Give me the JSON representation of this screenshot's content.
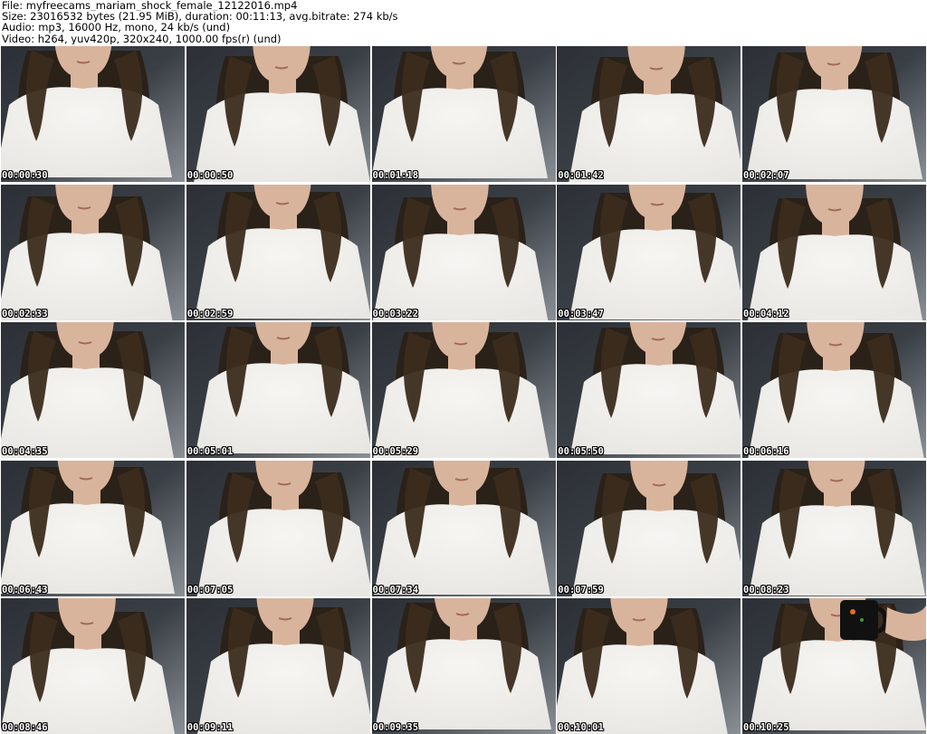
{
  "header": {
    "file_line": "File: myfreecams_mariam_shock_female_12122016.mp4",
    "size_line": "Size: 23016532 bytes (21.95 MiB), duration: 00:11:13, avg.bitrate: 274 kb/s",
    "audio_line": "Audio: mp3, 16000 Hz, mono, 24 kb/s (und)",
    "video_line": "Video: h264, yuv420p, 320x240, 1000.00 fps(r) (und)"
  },
  "thumbnails": [
    {
      "timestamp": "00:00:30"
    },
    {
      "timestamp": "00:00:50"
    },
    {
      "timestamp": "00:01:18"
    },
    {
      "timestamp": "00:01:42"
    },
    {
      "timestamp": "00:02:07"
    },
    {
      "timestamp": "00:02:33"
    },
    {
      "timestamp": "00:02:59"
    },
    {
      "timestamp": "00:03:22"
    },
    {
      "timestamp": "00:03:47"
    },
    {
      "timestamp": "00:04:12"
    },
    {
      "timestamp": "00:04:35"
    },
    {
      "timestamp": "00:05:01"
    },
    {
      "timestamp": "00:05:29"
    },
    {
      "timestamp": "00:05:50"
    },
    {
      "timestamp": "00:06:16"
    },
    {
      "timestamp": "00:06:43"
    },
    {
      "timestamp": "00:07:05"
    },
    {
      "timestamp": "00:07:34"
    },
    {
      "timestamp": "00:07:59"
    },
    {
      "timestamp": "00:08:23"
    },
    {
      "timestamp": "00:08:46"
    },
    {
      "timestamp": "00:09:11"
    },
    {
      "timestamp": "00:09:35"
    },
    {
      "timestamp": "00:10:01"
    },
    {
      "timestamp": "00:10:25"
    }
  ],
  "colors": {
    "background": "#ffffff",
    "header_text": "#000000",
    "timestamp_text": "#ffffff",
    "timestamp_outline": "#000000",
    "backdrop": "#3a3f46",
    "sweater": "#e8e6e2",
    "hair": "#2a2118",
    "skin": "#d9b49c"
  }
}
